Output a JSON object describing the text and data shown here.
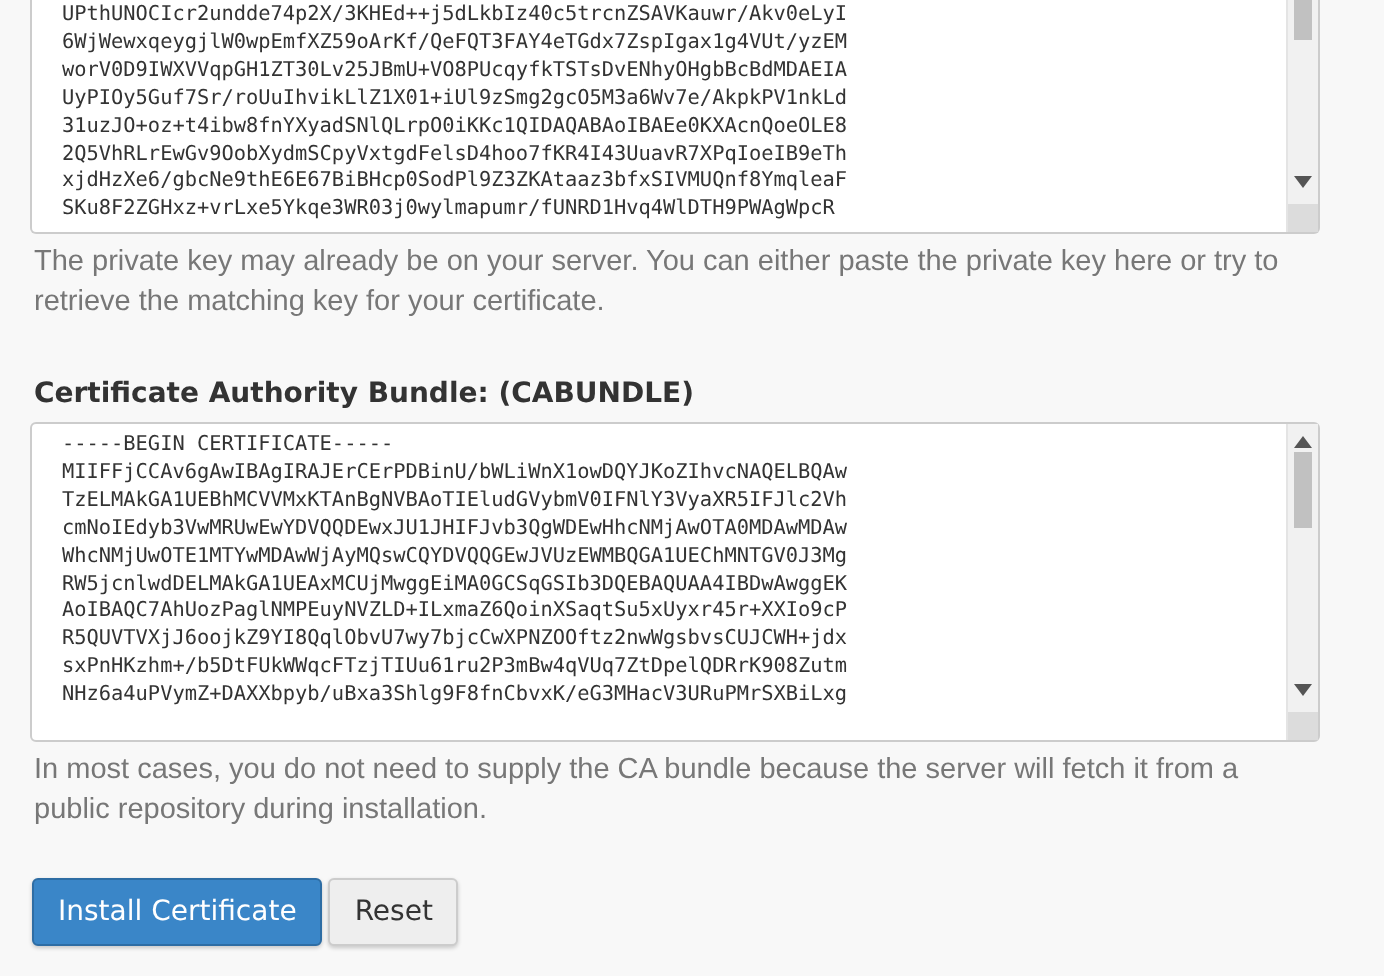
{
  "private_key": {
    "lines": [
      "UPthUNOCIcr2undde74p2X/3KHEd++j5dLkbIz40c5trcnZSAVKauwr/Akv0eLyI",
      "6WjWewxqeygjlW0wpEmfXZ59oArKf/QeFQT3FAY4eTGdx7ZspIgax1g4VUt/yzEM",
      "worV0D9IWXVVqpGH1ZT30Lv25JBmU+VO8PUcqyfkTSTsDvENhyOHgbBcBdMDAEIA",
      "UyPIOy5Guf7Sr/roUuIhvikLlZ1X01+iUl9zSmg2gcO5M3a6Wv7e/AkpkPV1nkLd",
      "31uzJO+oz+t4ibw8fnYXyadSNlQLrpO0iKKc1QIDAQABAoIBAEe0KXAcnQoeOLE8",
      "2Q5VhRLrEwGv9OobXydmSCpyVxtgdFelsD4hoo7fKR4I43UuavR7XPqIoeIB9eTh",
      "xjdHzXe6/gbcNe9thE6E67BiBHcp0SodPl9Z3ZKAtaaz3bfxSIVMUQnf8YmqleaF",
      "SKu8F2ZGHxz+vrLxe5Ykqe3WR03j0wylmapumr/fUNRD1Hvq4WlDTH9PWAgWpcR"
    ],
    "help": "The private key may already be on your server. You can either paste the private key here or try to retrieve the matching key for your certificate."
  },
  "ca_bundle": {
    "label": "Certificate Authority Bundle: (CABUNDLE)",
    "lines": [
      "-----BEGIN CERTIFICATE-----",
      "MIIFFjCCAv6gAwIBAgIRAJErCErPDBinU/bWLiWnX1owDQYJKoZIhvcNAQELBQAw",
      "TzELMAkGA1UEBhMCVVMxKTAnBgNVBAoTIEludGVybmV0IFNlY3VyaXR5IFJlc2Vh",
      "cmNoIEdyb3VwMRUwEwYDVQQDEwxJU1JHIFJvb3QgWDEwHhcNMjAwOTA0MDAwMDAw",
      "WhcNMjUwOTE1MTYwMDAwWjAyMQswCQYDVQQGEwJVUzEWMBQGA1UEChMNTGV0J3Mg",
      "RW5jcnlwdDELMAkGA1UEAxMCUjMwggEiMA0GCSqGSIb3DQEBAQUAA4IBDwAwggEK",
      "AoIBAQC7AhUozPaglNMPEuyNVZLD+ILxmaZ6QoinXSaqtSu5xUyxr45r+XXIo9cP",
      "R5QUVTVXjJ6oojkZ9YI8QqlObvU7wy7bjcCwXPNZOOftz2nwWgsbvsCUJCWH+jdx",
      "sxPnHKzhm+/b5DtFUkWWqcFTzjTIUu61ru2P3mBw4qVUq7ZtDpelQDRrK908Zutm",
      "NHz6a4uPVymZ+DAXXbpyb/uBxa3Shlg9F8fnCbvxK/eG3MHacV3URuPMrSXBiLxg"
    ],
    "help": "In most cases, you do not need to supply the CA bundle because the server will fetch it from a public repository during installation."
  },
  "buttons": [
    {
      "label": "Install Certificate",
      "kind": "primary"
    },
    {
      "label": "Reset",
      "kind": "default"
    }
  ]
}
